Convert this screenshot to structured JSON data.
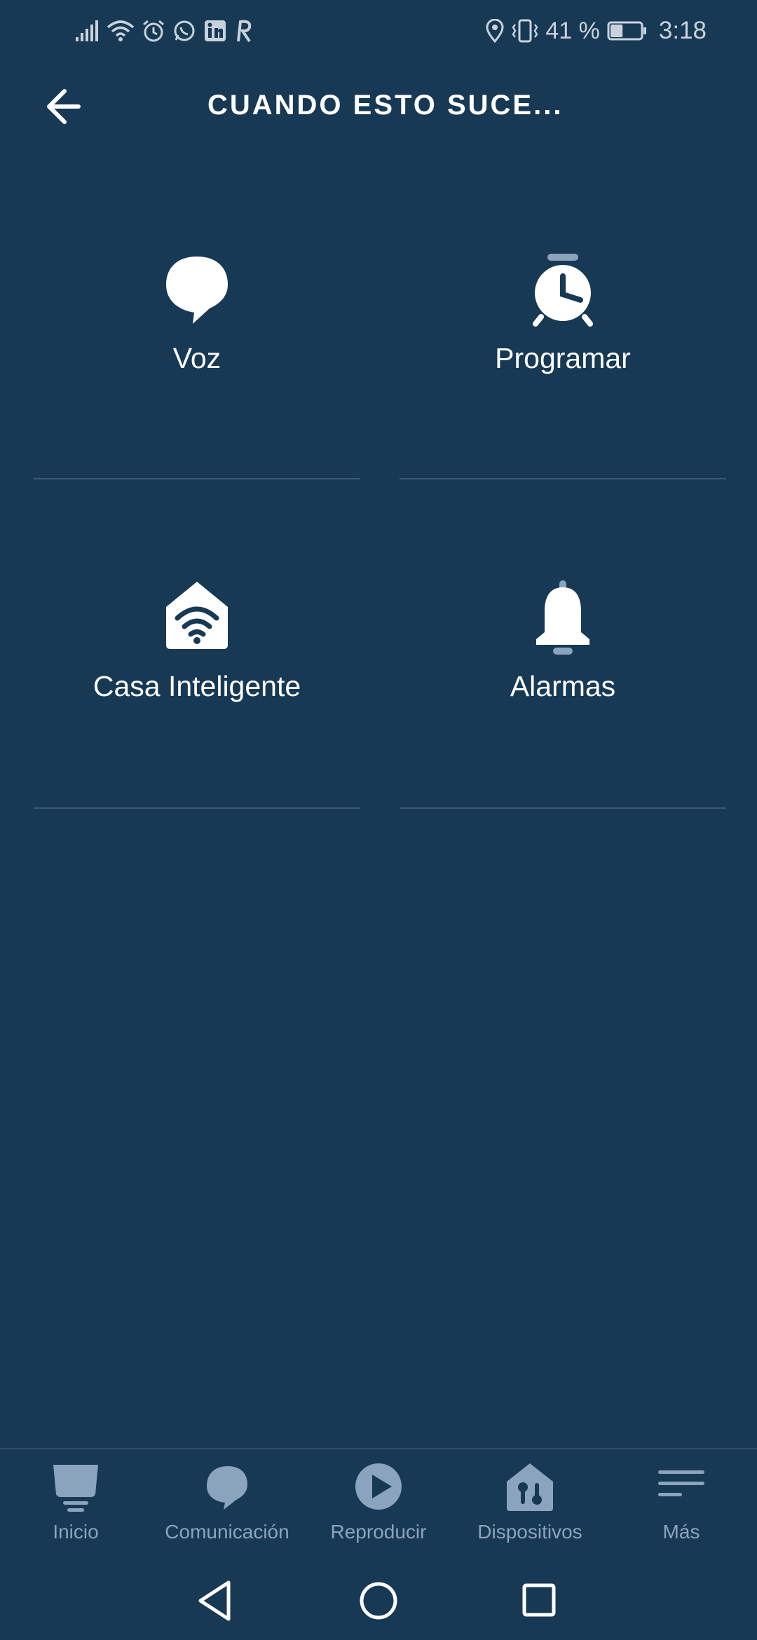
{
  "status_bar": {
    "battery_percent": "41 %",
    "battery_level": 0.41,
    "time": "3:18",
    "icons_left": [
      "signal-icon",
      "wifi-icon",
      "alarm-icon",
      "whatsapp-icon",
      "linkedin-icon",
      "r-app-icon"
    ],
    "icons_right": [
      "location-icon",
      "vibrate-icon",
      "battery-icon"
    ]
  },
  "header": {
    "title": "CUANDO ESTO SUCE..."
  },
  "triggers": [
    {
      "label": "Voz",
      "icon": "speech-bubble-icon"
    },
    {
      "label": "Programar",
      "icon": "alarm-clock-icon"
    },
    {
      "label": "Casa Inteligente",
      "icon": "smart-home-icon"
    },
    {
      "label": "Alarmas",
      "icon": "bell-icon"
    }
  ],
  "bottom_nav": {
    "items": [
      {
        "label": "Inicio",
        "icon": "home-icon"
      },
      {
        "label": "Comunicación",
        "icon": "chat-icon"
      },
      {
        "label": "Reproducir",
        "icon": "play-icon"
      },
      {
        "label": "Dispositivos",
        "icon": "devices-icon"
      },
      {
        "label": "Más",
        "icon": "menu-icon"
      }
    ]
  },
  "colors": {
    "background": "#183954",
    "divider": "#3d5a74",
    "nav_inactive": "#8ba4bd",
    "icon_white": "#ffffff"
  }
}
